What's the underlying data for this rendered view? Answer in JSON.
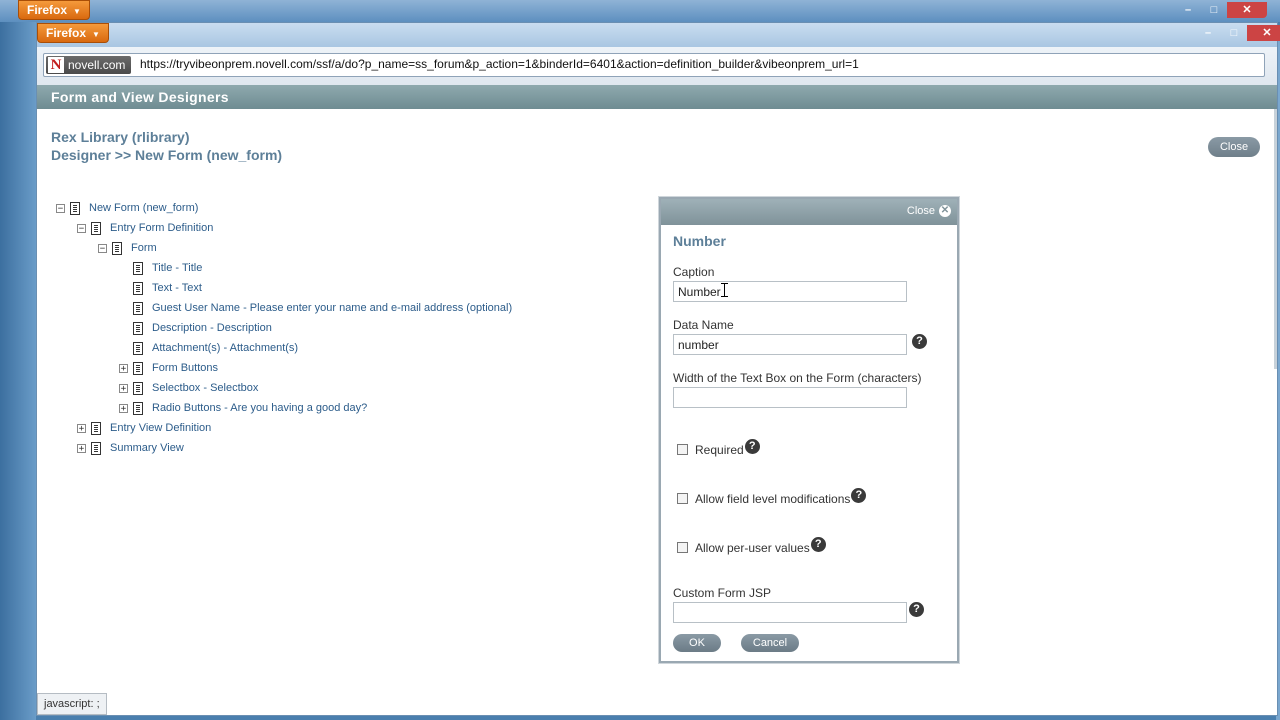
{
  "os": {
    "back_firefox_label": "Firefox",
    "winctl": {
      "min": "–",
      "max": "□",
      "close": "✕"
    }
  },
  "browser": {
    "firefox_label": "Firefox",
    "site_identity": "novell.com",
    "site_logo": "N",
    "url": "https://tryvibeonprem.novell.com/ssf/a/do?p_name=ss_forum&p_action=1&binderId=6401&action=definition_builder&vibeonprem_url=1",
    "status_text": "javascript: ;"
  },
  "page": {
    "header": "Form and View Designers",
    "breadcrumb_line1": "Rex Library (rlibrary)",
    "breadcrumb_line2": "Designer >> New Form (new_form)",
    "close_label": "Close"
  },
  "tree": [
    {
      "label": "New Form (new_form)",
      "toggle": "−"
    },
    {
      "label": "Entry Form Definition",
      "toggle": "−"
    },
    {
      "label": "Form",
      "toggle": "−"
    },
    {
      "label": "Title - Title",
      "toggle": ""
    },
    {
      "label": "Text - Text",
      "toggle": ""
    },
    {
      "label": "Guest User Name - Please enter your name and e-mail address (optional)",
      "toggle": ""
    },
    {
      "label": "Description - Description",
      "toggle": ""
    },
    {
      "label": "Attachment(s) - Attachment(s)",
      "toggle": ""
    },
    {
      "label": "Form Buttons",
      "toggle": "+"
    },
    {
      "label": "Selectbox - Selectbox",
      "toggle": "+"
    },
    {
      "label": "Radio Buttons - Are you having a good day?",
      "toggle": "+"
    },
    {
      "label": "Entry View Definition",
      "toggle": "+"
    },
    {
      "label": "Summary View",
      "toggle": "+"
    }
  ],
  "dialog": {
    "close_label": "Close",
    "close_glyph": "✕",
    "title": "Number",
    "caption_label": "Caption",
    "caption_value": "Number",
    "dataname_label": "Data Name",
    "dataname_value": "number",
    "width_label": "Width of the Text Box on the Form (characters)",
    "width_value": "",
    "required_label": "Required",
    "allow_field_label": "Allow field level modifications",
    "allow_peruser_label": "Allow per-user values",
    "custom_jsp_label": "Custom Form JSP",
    "custom_jsp_value": "",
    "help_glyph": "?",
    "ok_label": "OK",
    "cancel_label": "Cancel"
  }
}
